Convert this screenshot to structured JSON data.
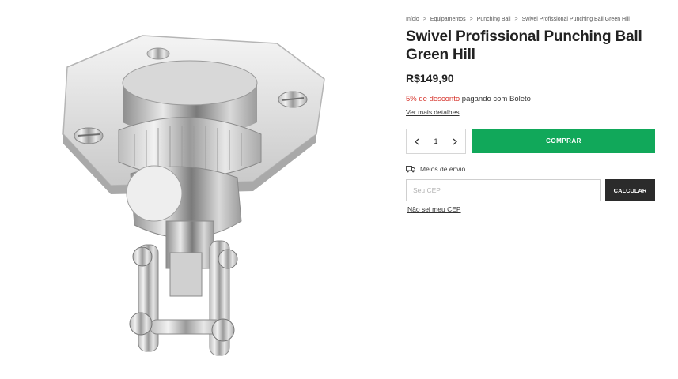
{
  "breadcrumb": {
    "items": [
      "Início",
      "Equipamentos",
      "Punching Ball",
      "Swivel Profissional Punching Ball Green Hill"
    ],
    "separator": ">"
  },
  "product": {
    "title": "Swivel Profissional Punching Ball Green Hill",
    "price": "R$149,90",
    "discount_highlight": "5% de desconto",
    "discount_rest": " pagando com Boleto",
    "more_details": "Ver mais detalhes",
    "image_icon": "swivel-product-photo"
  },
  "purchase": {
    "quantity": "1",
    "buy_label": "COMPRAR",
    "buy_color": "#11a85a"
  },
  "shipping": {
    "label": "Meios de envio",
    "icon": "truck-icon",
    "cep_placeholder": "Seu CEP",
    "calc_label": "CALCULAR",
    "no_cep_link": "Não sei meu CEP"
  },
  "colors": {
    "accent_green": "#11a85a",
    "discount_red": "#d6342c",
    "dark_button": "#2b2b2b"
  }
}
